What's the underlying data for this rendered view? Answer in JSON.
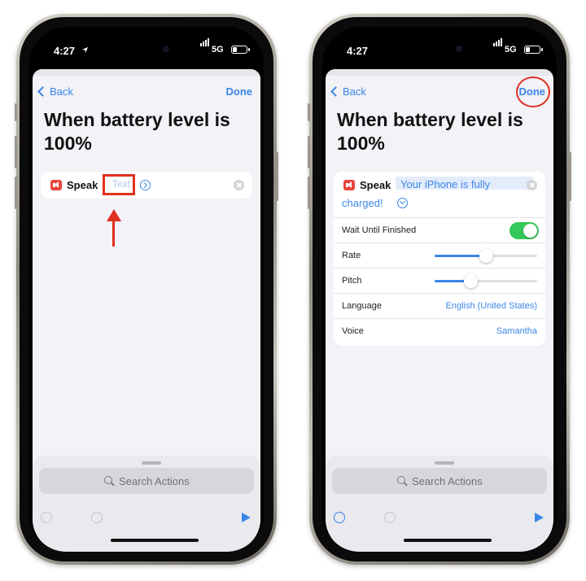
{
  "left_phone": {
    "status": {
      "time": "4:27",
      "network": "5G"
    },
    "nav": {
      "back_label": "Back",
      "done_label": "Done"
    },
    "title": "When battery level is 100%",
    "action": {
      "label": "Speak",
      "text_placeholder": "Text"
    },
    "bottom": {
      "search_placeholder": "Search Actions"
    }
  },
  "right_phone": {
    "status": {
      "time": "4:27",
      "network": "5G"
    },
    "nav": {
      "back_label": "Back",
      "done_label": "Done"
    },
    "title": "When battery level is 100%",
    "action": {
      "label": "Speak",
      "text_value_line1": "Your iPhone is fully",
      "text_value_line2": "charged!"
    },
    "options": {
      "wait_label": "Wait Until Finished",
      "wait_enabled": true,
      "rate_label": "Rate",
      "rate_value": 0.5,
      "pitch_label": "Pitch",
      "pitch_value": 0.35,
      "language_label": "Language",
      "language_value": "English (United States)",
      "voice_label": "Voice",
      "voice_value": "Samantha"
    },
    "bottom": {
      "search_placeholder": "Search Actions"
    }
  },
  "colors": {
    "accent": "#3a86e8",
    "annotation": "#e0301e",
    "toggle_on": "#34c759",
    "speak_icon": "#e8453c"
  },
  "icons": [
    "location-arrow-icon",
    "signal-icon",
    "battery-icon",
    "back-chevron-icon",
    "speaker-icon",
    "chevron-right-icon",
    "chevron-down-icon",
    "clear-icon",
    "search-icon",
    "undo-icon",
    "redo-icon",
    "play-icon"
  ]
}
